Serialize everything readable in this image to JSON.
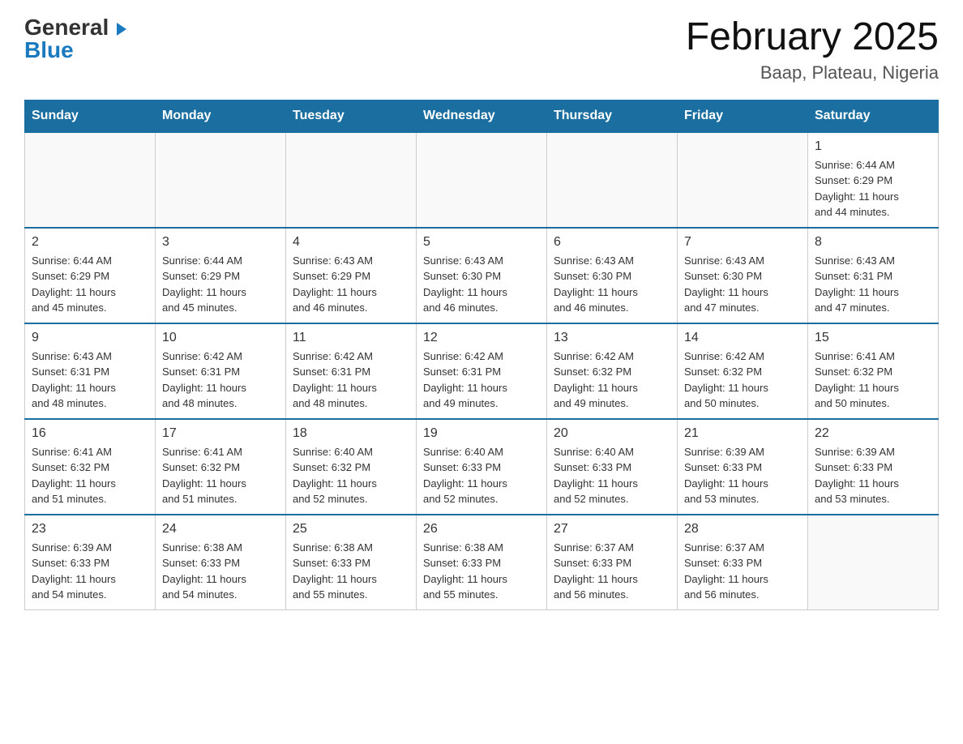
{
  "header": {
    "logo_general": "General",
    "logo_blue": "Blue",
    "title": "February 2025",
    "subtitle": "Baap, Plateau, Nigeria"
  },
  "weekdays": [
    "Sunday",
    "Monday",
    "Tuesday",
    "Wednesday",
    "Thursday",
    "Friday",
    "Saturday"
  ],
  "weeks": [
    [
      {
        "day": "",
        "info": ""
      },
      {
        "day": "",
        "info": ""
      },
      {
        "day": "",
        "info": ""
      },
      {
        "day": "",
        "info": ""
      },
      {
        "day": "",
        "info": ""
      },
      {
        "day": "",
        "info": ""
      },
      {
        "day": "1",
        "info": "Sunrise: 6:44 AM\nSunset: 6:29 PM\nDaylight: 11 hours\nand 44 minutes."
      }
    ],
    [
      {
        "day": "2",
        "info": "Sunrise: 6:44 AM\nSunset: 6:29 PM\nDaylight: 11 hours\nand 45 minutes."
      },
      {
        "day": "3",
        "info": "Sunrise: 6:44 AM\nSunset: 6:29 PM\nDaylight: 11 hours\nand 45 minutes."
      },
      {
        "day": "4",
        "info": "Sunrise: 6:43 AM\nSunset: 6:29 PM\nDaylight: 11 hours\nand 46 minutes."
      },
      {
        "day": "5",
        "info": "Sunrise: 6:43 AM\nSunset: 6:30 PM\nDaylight: 11 hours\nand 46 minutes."
      },
      {
        "day": "6",
        "info": "Sunrise: 6:43 AM\nSunset: 6:30 PM\nDaylight: 11 hours\nand 46 minutes."
      },
      {
        "day": "7",
        "info": "Sunrise: 6:43 AM\nSunset: 6:30 PM\nDaylight: 11 hours\nand 47 minutes."
      },
      {
        "day": "8",
        "info": "Sunrise: 6:43 AM\nSunset: 6:31 PM\nDaylight: 11 hours\nand 47 minutes."
      }
    ],
    [
      {
        "day": "9",
        "info": "Sunrise: 6:43 AM\nSunset: 6:31 PM\nDaylight: 11 hours\nand 48 minutes."
      },
      {
        "day": "10",
        "info": "Sunrise: 6:42 AM\nSunset: 6:31 PM\nDaylight: 11 hours\nand 48 minutes."
      },
      {
        "day": "11",
        "info": "Sunrise: 6:42 AM\nSunset: 6:31 PM\nDaylight: 11 hours\nand 48 minutes."
      },
      {
        "day": "12",
        "info": "Sunrise: 6:42 AM\nSunset: 6:31 PM\nDaylight: 11 hours\nand 49 minutes."
      },
      {
        "day": "13",
        "info": "Sunrise: 6:42 AM\nSunset: 6:32 PM\nDaylight: 11 hours\nand 49 minutes."
      },
      {
        "day": "14",
        "info": "Sunrise: 6:42 AM\nSunset: 6:32 PM\nDaylight: 11 hours\nand 50 minutes."
      },
      {
        "day": "15",
        "info": "Sunrise: 6:41 AM\nSunset: 6:32 PM\nDaylight: 11 hours\nand 50 minutes."
      }
    ],
    [
      {
        "day": "16",
        "info": "Sunrise: 6:41 AM\nSunset: 6:32 PM\nDaylight: 11 hours\nand 51 minutes."
      },
      {
        "day": "17",
        "info": "Sunrise: 6:41 AM\nSunset: 6:32 PM\nDaylight: 11 hours\nand 51 minutes."
      },
      {
        "day": "18",
        "info": "Sunrise: 6:40 AM\nSunset: 6:32 PM\nDaylight: 11 hours\nand 52 minutes."
      },
      {
        "day": "19",
        "info": "Sunrise: 6:40 AM\nSunset: 6:33 PM\nDaylight: 11 hours\nand 52 minutes."
      },
      {
        "day": "20",
        "info": "Sunrise: 6:40 AM\nSunset: 6:33 PM\nDaylight: 11 hours\nand 52 minutes."
      },
      {
        "day": "21",
        "info": "Sunrise: 6:39 AM\nSunset: 6:33 PM\nDaylight: 11 hours\nand 53 minutes."
      },
      {
        "day": "22",
        "info": "Sunrise: 6:39 AM\nSunset: 6:33 PM\nDaylight: 11 hours\nand 53 minutes."
      }
    ],
    [
      {
        "day": "23",
        "info": "Sunrise: 6:39 AM\nSunset: 6:33 PM\nDaylight: 11 hours\nand 54 minutes."
      },
      {
        "day": "24",
        "info": "Sunrise: 6:38 AM\nSunset: 6:33 PM\nDaylight: 11 hours\nand 54 minutes."
      },
      {
        "day": "25",
        "info": "Sunrise: 6:38 AM\nSunset: 6:33 PM\nDaylight: 11 hours\nand 55 minutes."
      },
      {
        "day": "26",
        "info": "Sunrise: 6:38 AM\nSunset: 6:33 PM\nDaylight: 11 hours\nand 55 minutes."
      },
      {
        "day": "27",
        "info": "Sunrise: 6:37 AM\nSunset: 6:33 PM\nDaylight: 11 hours\nand 56 minutes."
      },
      {
        "day": "28",
        "info": "Sunrise: 6:37 AM\nSunset: 6:33 PM\nDaylight: 11 hours\nand 56 minutes."
      },
      {
        "day": "",
        "info": ""
      }
    ]
  ]
}
